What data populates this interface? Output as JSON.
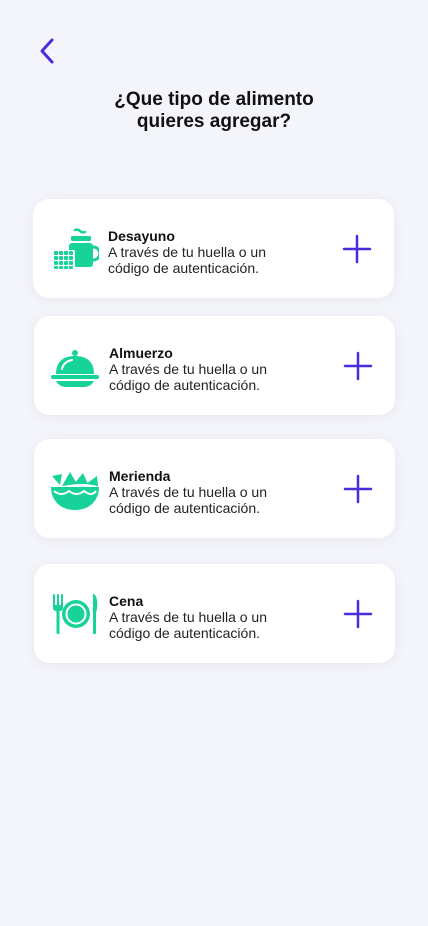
{
  "header": {
    "back_icon": "chevron-left-icon",
    "title_line1": "¿Que tipo de alimento",
    "title_line2": "quieres agregar?"
  },
  "colors": {
    "background": "#f4f5fa",
    "accent": "#4b2bdc",
    "icon": "#17d39a"
  },
  "meals": [
    {
      "icon": "breakfast-icon",
      "name": "Desayuno",
      "desc_line1": "A través de tu huella o un",
      "desc_line2": "código de autenticación."
    },
    {
      "icon": "lunch-cloche-icon",
      "name": "Almuerzo",
      "desc_line1": "A través de tu huella o un",
      "desc_line2": "código de autenticación."
    },
    {
      "icon": "snack-bowl-icon",
      "name": "Merienda",
      "desc_line1": "A través de tu huella o un",
      "desc_line2": "código de autenticación."
    },
    {
      "icon": "dinner-plate-icon",
      "name": "Cena",
      "desc_line1": "A través de tu huella o un",
      "desc_line2": "código de autenticación."
    }
  ]
}
